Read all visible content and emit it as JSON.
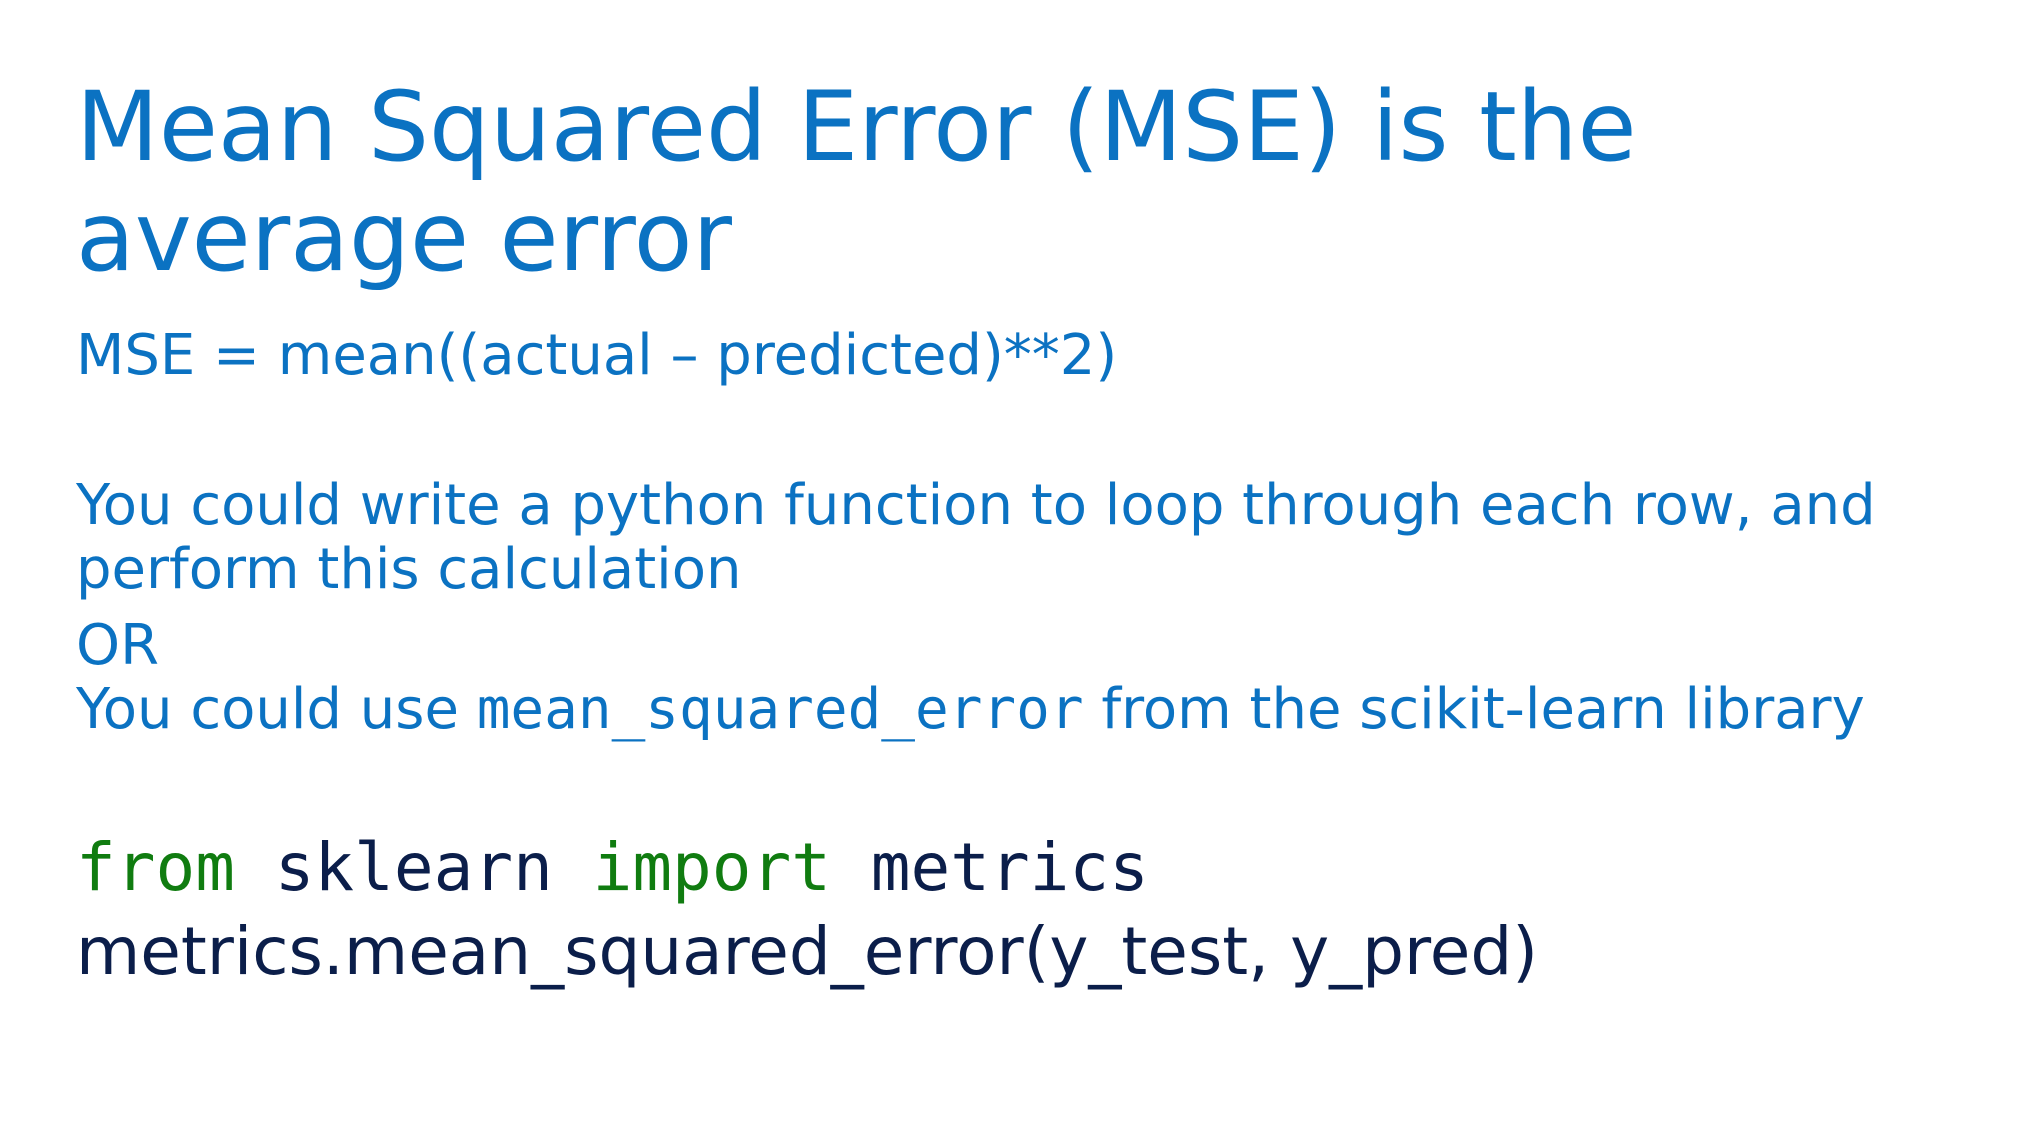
{
  "slide": {
    "title": "Mean Squared Error (MSE) is the average error",
    "formula": "MSE = mean((actual – predicted)**2)",
    "paragraph_line1": "You could write a python function to loop through each row, and",
    "paragraph_line2": "perform this calculation",
    "or_text": "OR",
    "use_prefix": "You could use ",
    "use_code": "mean_squared_error",
    "use_suffix": "  from the scikit-learn library",
    "code": {
      "kw_from": "from",
      "module": " sklearn ",
      "kw_import": "import",
      "name": " metrics",
      "call": "metrics.mean_squared_error(y_test, y_pred)"
    }
  },
  "colors": {
    "text_blue": "#0B72C2",
    "code_dark": "#0B1E4A",
    "keyword_green": "#107C10",
    "background": "#ffffff"
  }
}
